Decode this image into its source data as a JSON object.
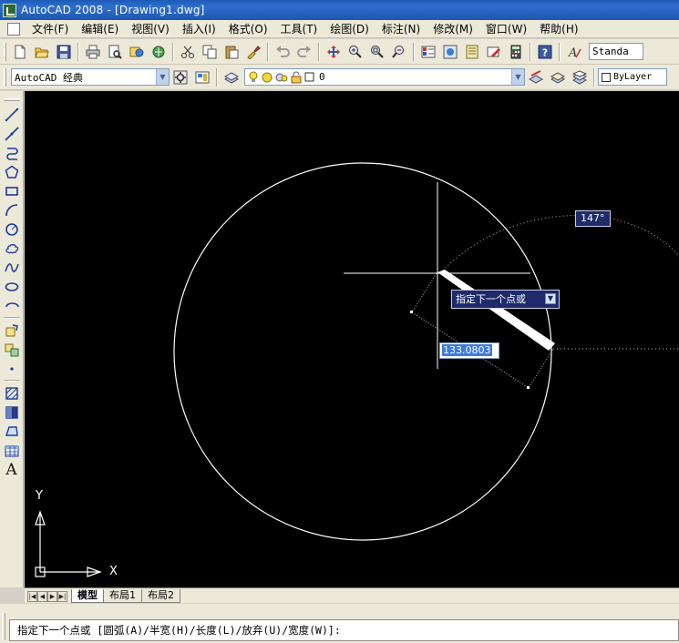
{
  "window": {
    "title": "AutoCAD 2008 - [Drawing1.dwg]"
  },
  "menubar": {
    "items": [
      "文件(F)",
      "编辑(E)",
      "视图(V)",
      "插入(I)",
      "格式(O)",
      "工具(T)",
      "绘图(D)",
      "标注(N)",
      "修改(M)",
      "窗口(W)",
      "帮助(H)"
    ]
  },
  "toolbar1": {
    "icons": [
      "new-icon",
      "open-icon",
      "save-icon",
      "print-icon",
      "plot-preview-icon",
      "publish-icon",
      "cut-icon",
      "copy-icon",
      "paste-icon",
      "match-properties-icon",
      "undo-icon",
      "redo-icon",
      "pan-icon",
      "zoom-realtime-icon",
      "zoom-window-icon",
      "zoom-previous-icon",
      "properties-icon",
      "design-center-icon",
      "tool-palettes-icon",
      "markup-icon",
      "calculator-icon",
      "help-icon",
      "text-style-icon"
    ],
    "text_style_value": "Standa"
  },
  "toolbar2": {
    "workspace_value": "AutoCAD 经典",
    "layer_value": "0",
    "color_value": "ByLayer"
  },
  "left_toolbar": {
    "icons": [
      "line-icon",
      "construction-line-icon",
      "polyline-icon",
      "polygon-icon",
      "rectangle-icon",
      "arc-icon",
      "circle-icon",
      "revision-cloud-icon",
      "spline-icon",
      "ellipse-icon",
      "ellipse-arc-icon",
      "insert-block-icon",
      "make-block-icon",
      "point-icon",
      "hatch-icon",
      "gradient-icon",
      "region-icon",
      "table-icon",
      "multiline-text-icon"
    ],
    "text_button_label": "A"
  },
  "canvas": {
    "angle_tooltip": "147°",
    "prompt_tooltip": "指定下一个点或",
    "distance_input": "133.0803",
    "ucs_y_label": "Y",
    "ucs_x_label": "X"
  },
  "tabs": {
    "items": [
      "模型",
      "布局1",
      "布局2"
    ],
    "active": "模型"
  },
  "command_line": {
    "text": "指定下一个点或 [圆弧(A)/半宽(H)/长度(L)/放弃(U)/宽度(W)]:"
  },
  "colors": {
    "canvas_bg": "#000000",
    "title_bar": "#1d5bb5",
    "tooltip_bg": "#1f2a6b",
    "input_highlight": "#3d7be0"
  }
}
